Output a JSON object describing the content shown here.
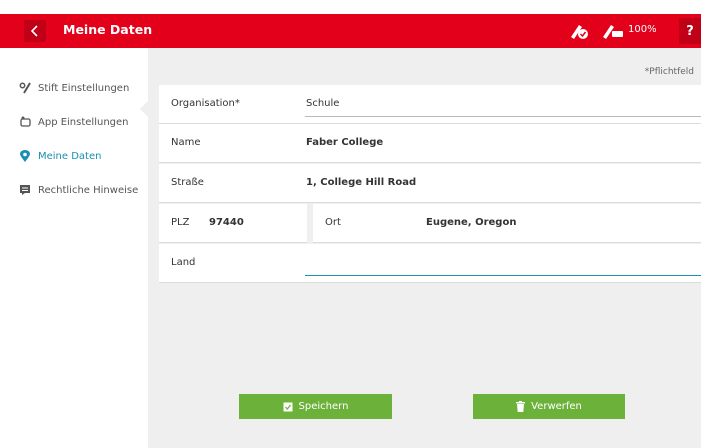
{
  "header": {
    "title": "Meine Daten",
    "battery_label": "100%",
    "help_label": "?"
  },
  "sidebar": {
    "items": [
      {
        "label": "Stift Einstellungen",
        "icon": "pen-settings-icon"
      },
      {
        "label": "App Einstellungen",
        "icon": "app-settings-icon"
      },
      {
        "label": "Meine Daten",
        "icon": "location-pin-icon",
        "active": true
      },
      {
        "label": "Rechtliche Hinweise",
        "icon": "document-icon"
      }
    ]
  },
  "form": {
    "required_note": "*Pflichtfeld",
    "organisation": {
      "label": "Organisation*",
      "value": "Schule"
    },
    "name": {
      "label": "Name",
      "value": "Faber College"
    },
    "street": {
      "label": "Straße",
      "value": "1, College Hill Road"
    },
    "plz": {
      "label": "PLZ",
      "value": "97440"
    },
    "city": {
      "label": "Ort",
      "value": "Eugene, Oregon"
    },
    "country": {
      "label": "Land",
      "value": ""
    }
  },
  "actions": {
    "save_label": "Speichern",
    "discard_label": "Verwerfen"
  },
  "colors": {
    "header": "#e2001a",
    "accent": "#1a8fb3",
    "button": "#6cb23a",
    "background": "#efefef"
  }
}
